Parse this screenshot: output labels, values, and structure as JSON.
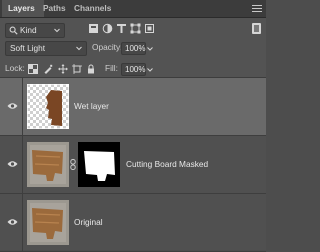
{
  "tabs": [
    {
      "label": "Layers",
      "active": true
    },
    {
      "label": "Paths",
      "active": false
    },
    {
      "label": "Channels",
      "active": false
    }
  ],
  "filter": {
    "kind_label": "Kind",
    "icons": [
      "pixel-layer-filter-icon",
      "adjustment-layer-filter-icon",
      "type-layer-filter-icon",
      "shape-layer-filter-icon",
      "smart-object-filter-icon",
      "filter-toggle-icon"
    ]
  },
  "blend": {
    "mode": "Soft Light",
    "opacity_label": "Opacity:",
    "opacity_value": "100%"
  },
  "lock": {
    "label": "Lock:",
    "icons": [
      "lock-transparent-pixels-icon",
      "lock-image-pixels-icon",
      "lock-position-icon",
      "lock-artboard-icon",
      "lock-all-icon"
    ],
    "fill_label": "Fill:",
    "fill_value": "100%"
  },
  "layers": [
    {
      "name": "Wet layer",
      "visible": true,
      "selected": true,
      "has_mask": false
    },
    {
      "name": "Cutting Board Masked",
      "visible": true,
      "selected": false,
      "has_mask": true
    },
    {
      "name": "Original",
      "visible": true,
      "selected": false,
      "has_mask": false
    }
  ],
  "colors": {
    "panel_bg": "#535353",
    "selected_row": "#6a6a6a",
    "wood": "#9b6a3c",
    "wet_wood": "#7a4624",
    "mask_white": "#ffffff",
    "mask_black": "#000000"
  }
}
